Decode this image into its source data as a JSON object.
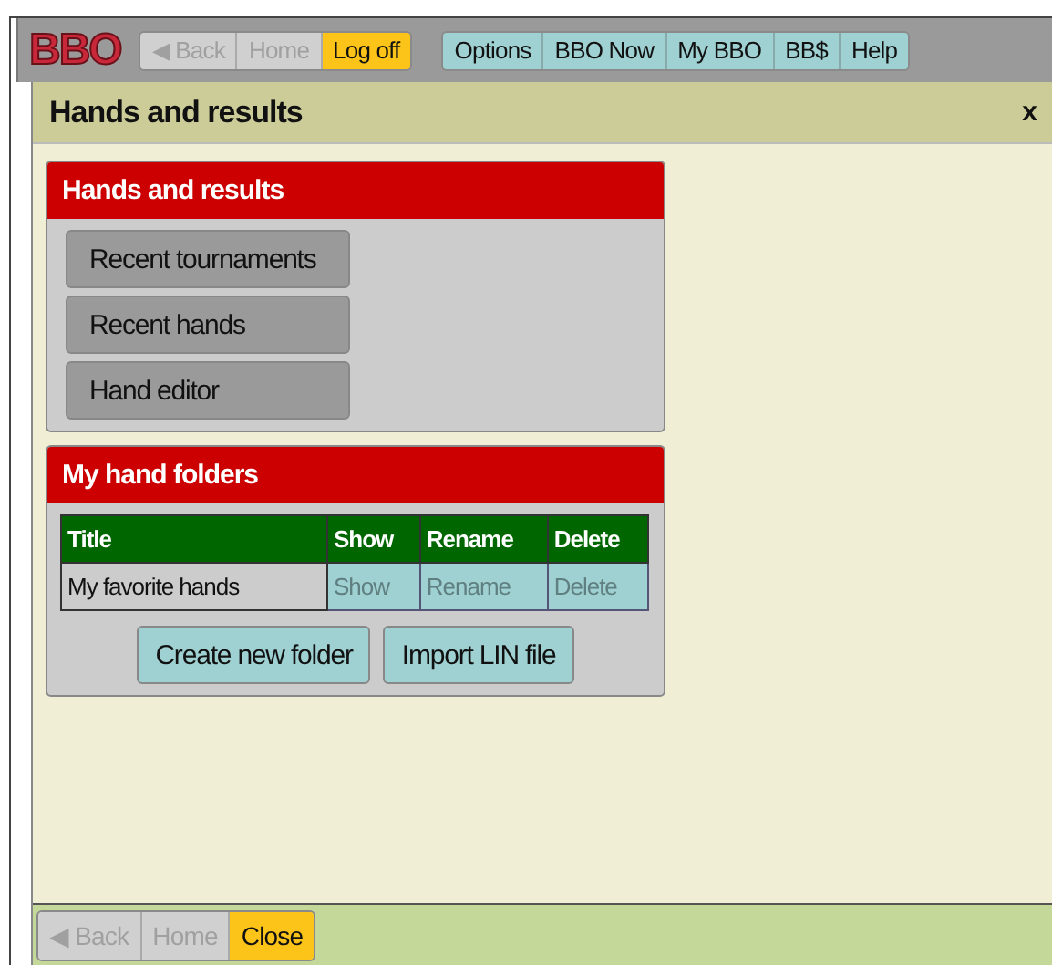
{
  "top_bar": {
    "logo": "BBO",
    "nav_groups": [
      [
        {
          "label": "◀ Back",
          "disabled": true,
          "highlighted": false
        },
        {
          "label": "Home",
          "disabled": true,
          "highlighted": false
        },
        {
          "label": "Log off",
          "disabled": false,
          "highlighted": true
        }
      ],
      [
        {
          "label": "Options",
          "disabled": false,
          "highlighted": false
        },
        {
          "label": "BBO Now",
          "disabled": false,
          "highlighted": false
        },
        {
          "label": "My BBO",
          "disabled": false,
          "highlighted": false
        },
        {
          "label": "BB$",
          "disabled": false,
          "highlighted": false
        },
        {
          "label": "Help",
          "disabled": false,
          "highlighted": false
        }
      ]
    ]
  },
  "panel": {
    "title": "Hands and results",
    "close": "x",
    "sections": [
      {
        "kind": "menu",
        "title": "Hands and results",
        "buttons": [
          "Recent tournaments",
          "Recent hands",
          "Hand editor"
        ]
      },
      {
        "kind": "folders",
        "title": "My hand folders",
        "table": {
          "columns": [
            "Title",
            "Show",
            "Rename",
            "Delete"
          ],
          "rows": [
            [
              {
                "text": "My favorite hands"
              },
              {
                "text": "Show",
                "disabled": true
              },
              {
                "text": "Rename",
                "disabled": true
              },
              {
                "text": "Delete",
                "disabled": true
              }
            ]
          ]
        },
        "buttons": [
          "Create new folder",
          "Import LIN file"
        ]
      }
    ]
  },
  "bottom_bar": {
    "buttons": [
      {
        "label": "◀ Back",
        "disabled": true,
        "highlighted": false
      },
      {
        "label": "Home",
        "disabled": true,
        "highlighted": false
      },
      {
        "label": "Close",
        "disabled": false,
        "highlighted": true
      }
    ]
  }
}
